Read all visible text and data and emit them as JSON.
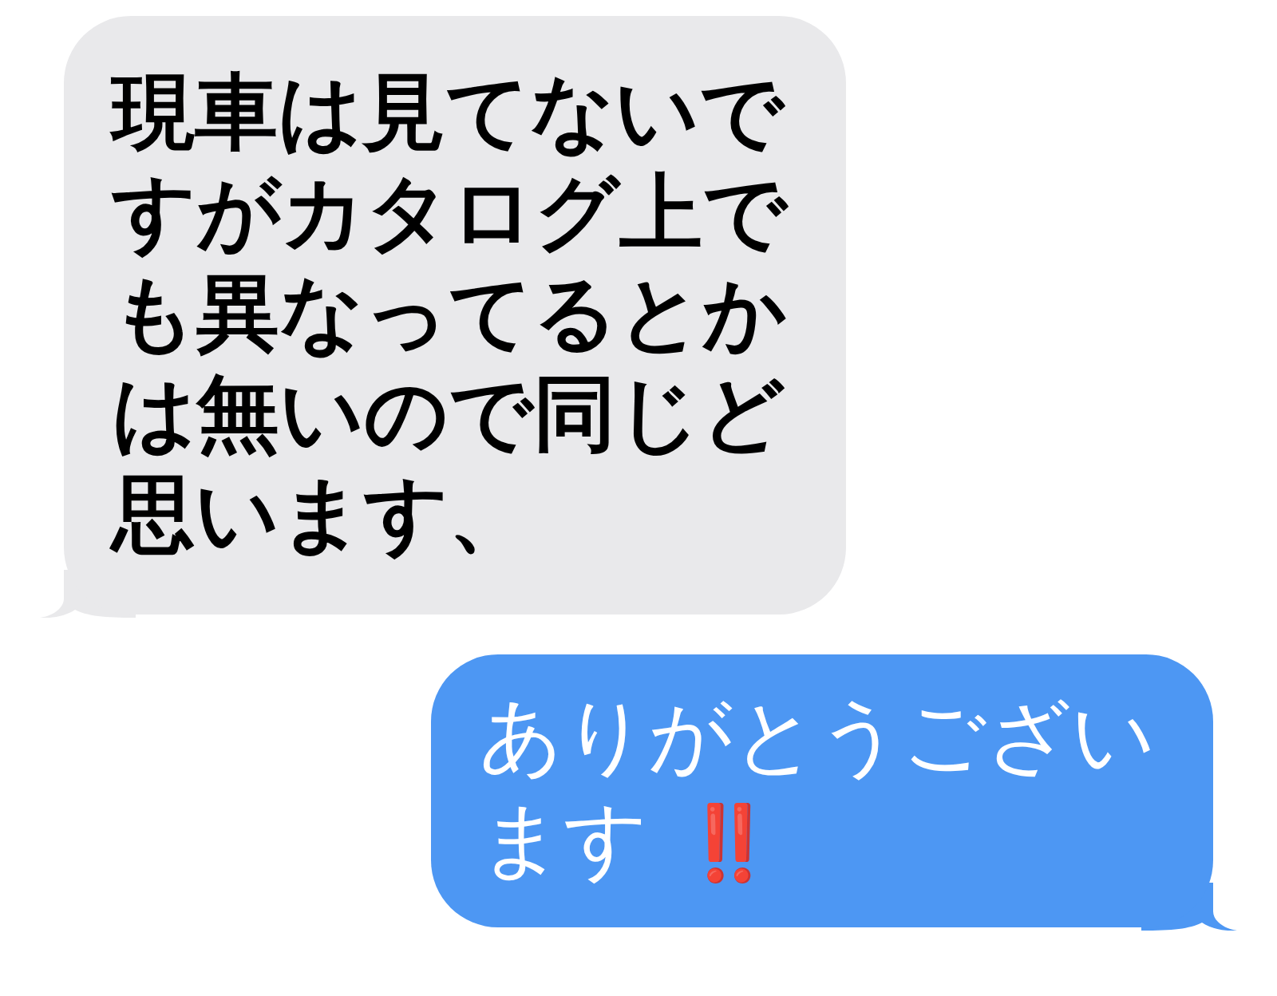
{
  "messages": [
    {
      "kind": "received",
      "text": "現車は見てないですがカタログ上でも異なってるとかは無いので同じど思います、"
    },
    {
      "kind": "sent",
      "text": "ありがとうございます",
      "emoji": "‼️"
    }
  ]
}
